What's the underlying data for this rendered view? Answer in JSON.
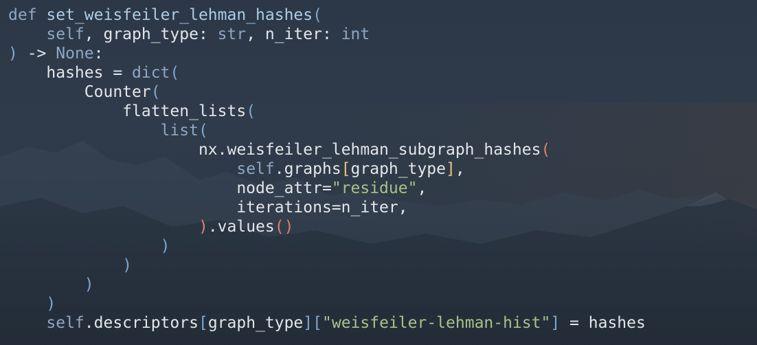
{
  "code": {
    "lines": [
      [
        {
          "t": "def",
          "c": "kw"
        },
        {
          "t": " "
        },
        {
          "t": "set_weisfeiler_lehman_hashes",
          "c": "defname"
        },
        {
          "t": "(",
          "c": "p-blue"
        }
      ],
      [
        {
          "t": "    "
        },
        {
          "t": "self",
          "c": "self"
        },
        {
          "t": ", graph_type: ",
          "c": "id"
        },
        {
          "t": "str",
          "c": "type"
        },
        {
          "t": ", n_iter: ",
          "c": "id"
        },
        {
          "t": "int",
          "c": "type"
        }
      ],
      [
        {
          "t": ")",
          "c": "p-blue"
        },
        {
          "t": " -> ",
          "c": "id"
        },
        {
          "t": "None",
          "c": "type"
        },
        {
          "t": ":",
          "c": "id"
        }
      ],
      [
        {
          "t": "    hashes = ",
          "c": "id"
        },
        {
          "t": "dict",
          "c": "builtin"
        },
        {
          "t": "(",
          "c": "p-blue"
        }
      ],
      [
        {
          "t": "        Counter",
          "c": "id"
        },
        {
          "t": "(",
          "c": "p-blue"
        }
      ],
      [
        {
          "t": "            flatten_lists",
          "c": "id"
        },
        {
          "t": "(",
          "c": "p-blue"
        }
      ],
      [
        {
          "t": "                "
        },
        {
          "t": "list",
          "c": "builtin"
        },
        {
          "t": "(",
          "c": "p-blue"
        }
      ],
      [
        {
          "t": "                    nx.weisfeiler_lehman_subgraph_hashes",
          "c": "id"
        },
        {
          "t": "(",
          "c": "p-orange"
        }
      ],
      [
        {
          "t": "                        "
        },
        {
          "t": "self",
          "c": "self"
        },
        {
          "t": ".graphs",
          "c": "id"
        },
        {
          "t": "[",
          "c": "p-yellow"
        },
        {
          "t": "graph_type",
          "c": "id"
        },
        {
          "t": "]",
          "c": "p-yellow"
        },
        {
          "t": ",",
          "c": "id"
        }
      ],
      [
        {
          "t": "                        node_attr=",
          "c": "id"
        },
        {
          "t": "\"residue\"",
          "c": "str"
        },
        {
          "t": ",",
          "c": "id"
        }
      ],
      [
        {
          "t": "                        iterations=n_iter,",
          "c": "id"
        }
      ],
      [
        {
          "t": "                    "
        },
        {
          "t": ")",
          "c": "p-orange"
        },
        {
          "t": ".values",
          "c": "id"
        },
        {
          "t": "()",
          "c": "p-orange"
        }
      ],
      [
        {
          "t": "                "
        },
        {
          "t": ")",
          "c": "p-blue"
        }
      ],
      [
        {
          "t": "            "
        },
        {
          "t": ")",
          "c": "p-blue"
        }
      ],
      [
        {
          "t": "        "
        },
        {
          "t": ")",
          "c": "p-blue"
        }
      ],
      [
        {
          "t": "    "
        },
        {
          "t": ")",
          "c": "p-blue"
        }
      ],
      [
        {
          "t": "    "
        },
        {
          "t": "self",
          "c": "self"
        },
        {
          "t": ".descriptors",
          "c": "id"
        },
        {
          "t": "[",
          "c": "p-blue"
        },
        {
          "t": "graph_type",
          "c": "id"
        },
        {
          "t": "]",
          "c": "p-blue"
        },
        {
          "t": "[",
          "c": "p-blue"
        },
        {
          "t": "\"weisfeiler-lehman-hist\"",
          "c": "str"
        },
        {
          "t": "]",
          "c": "p-blue"
        },
        {
          "t": " = hashes",
          "c": "id"
        }
      ]
    ]
  },
  "theme": {
    "background": "#2e3a48",
    "keyword": "#8fa6c4",
    "string": "#a9c287",
    "bracket_blue": "#7fa7cf",
    "bracket_orange": "#d9826a",
    "bracket_yellow": "#e6c67a",
    "text": "#e3e6ea"
  }
}
